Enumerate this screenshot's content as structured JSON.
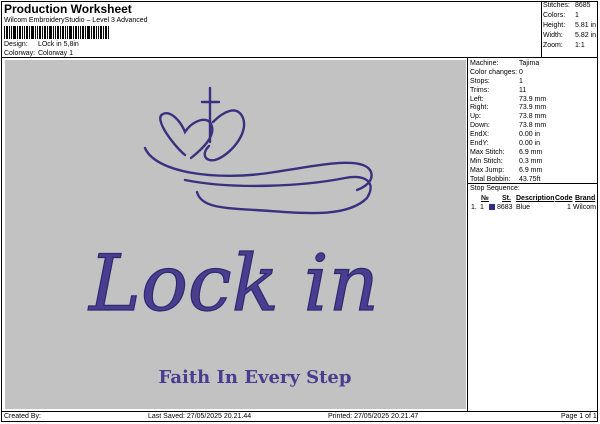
{
  "header": {
    "title": "Production Worksheet",
    "subtitle": "Wilcom EmbroideryStudio – Level 3 Advanced",
    "design_label": "Design:",
    "design_value": "LOck in 5,8in",
    "colorway_label": "Colorway:",
    "colorway_value": "Colorway 1"
  },
  "summary": [
    {
      "label": "Stitches:",
      "value": "8685"
    },
    {
      "label": "Colors:",
      "value": "1"
    },
    {
      "label": "Height:",
      "value": "5.81 in"
    },
    {
      "label": "Width:",
      "value": "5.82 in"
    },
    {
      "label": "Zoom:",
      "value": "1:1"
    }
  ],
  "machine_info": [
    {
      "label": "Machine:",
      "value": "Tajima"
    },
    {
      "label": "Color changes:",
      "value": "0"
    },
    {
      "label": "Stops:",
      "value": "1"
    },
    {
      "label": "Trims:",
      "value": "11"
    },
    {
      "label": "Left:",
      "value": "73.9 mm"
    },
    {
      "label": "Right:",
      "value": "73.9 mm"
    },
    {
      "label": "Up:",
      "value": "73.8 mm"
    },
    {
      "label": "Down:",
      "value": "73.8 mm"
    },
    {
      "label": "EndX:",
      "value": "0.00 in"
    },
    {
      "label": "EndY:",
      "value": "0.00 in"
    },
    {
      "label": "Max Stitch:",
      "value": "6.9 mm"
    },
    {
      "label": "Min Stitch:",
      "value": "0.3 mm"
    },
    {
      "label": "Max Jump:",
      "value": "6.9 mm"
    },
    {
      "label": "Total Bobbin:",
      "value": "43.75ft"
    }
  ],
  "stop_sequence": {
    "title": "Stop Sequence:",
    "headers": [
      "№",
      "St.",
      "Description",
      "Code",
      "Brand"
    ],
    "rows": [
      {
        "index": "1.",
        "num": "1",
        "st": "8683",
        "description": "Blue",
        "code": "1",
        "brand": "Wilcom"
      }
    ],
    "swatch_color": "#2e2b8a"
  },
  "design": {
    "main_text": "Lock in",
    "tagline": "Faith In Every Step",
    "thread_color": "#4a3d8f",
    "background": "#c2c2c2"
  },
  "footer": {
    "created_by": "Created By:",
    "last_saved": "Last Saved: 27/05/2025 20.21.44",
    "printed": "Printed: 27/05/2025 20.21.47",
    "page": "Page 1 of 1"
  }
}
